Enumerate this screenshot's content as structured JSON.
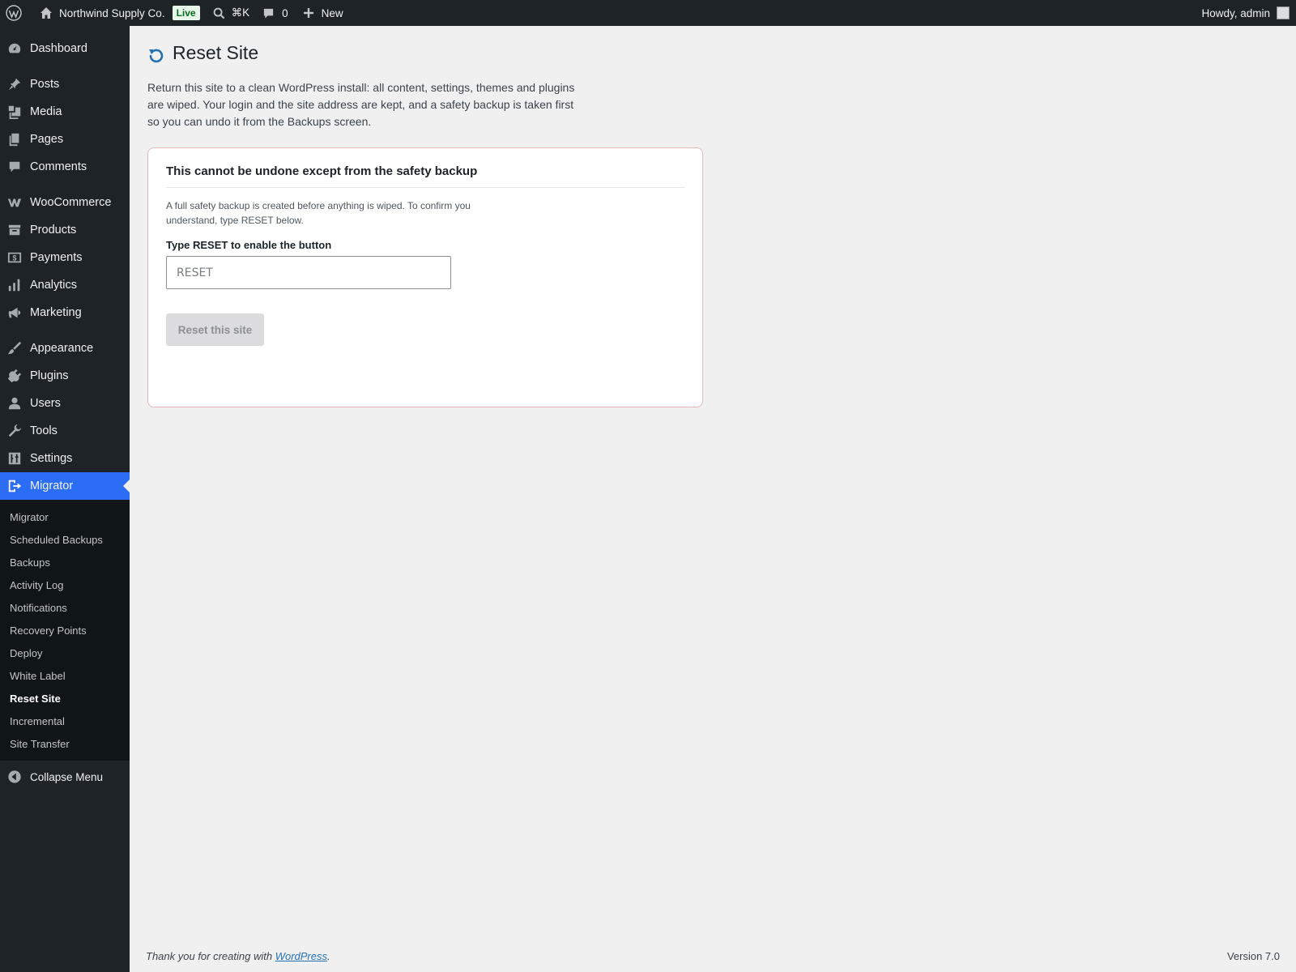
{
  "adminbar": {
    "site_name": "Northwind Supply Co.",
    "live_badge": "Live",
    "search_shortcut": "⌘K",
    "comments_count": "0",
    "new_label": "New",
    "greeting": "Howdy, admin"
  },
  "sidebar": {
    "items": [
      {
        "label": "Dashboard",
        "icon": "dashboard-icon"
      },
      {
        "label": "Posts",
        "icon": "pin-icon"
      },
      {
        "label": "Media",
        "icon": "media-icon"
      },
      {
        "label": "Pages",
        "icon": "pages-icon"
      },
      {
        "label": "Comments",
        "icon": "comment-icon"
      },
      {
        "label": "WooCommerce",
        "icon": "woocommerce-icon"
      },
      {
        "label": "Products",
        "icon": "archive-icon"
      },
      {
        "label": "Payments",
        "icon": "dollar-icon"
      },
      {
        "label": "Analytics",
        "icon": "bar-chart-icon"
      },
      {
        "label": "Marketing",
        "icon": "megaphone-icon"
      },
      {
        "label": "Appearance",
        "icon": "brush-icon"
      },
      {
        "label": "Plugins",
        "icon": "plug-icon"
      },
      {
        "label": "Users",
        "icon": "user-icon"
      },
      {
        "label": "Tools",
        "icon": "wrench-icon"
      },
      {
        "label": "Settings",
        "icon": "sliders-icon"
      },
      {
        "label": "Migrator",
        "icon": "migrate-icon"
      }
    ],
    "submenu": [
      "Migrator",
      "Scheduled Backups",
      "Backups",
      "Activity Log",
      "Notifications",
      "Recovery Points",
      "Deploy",
      "White Label",
      "Reset Site",
      "Incremental",
      "Site Transfer"
    ],
    "collapse_label": "Collapse Menu"
  },
  "main": {
    "title": "Reset Site",
    "intro": "Return this site to a clean WordPress install: all content, settings, themes and plugins are wiped. Your login and the site address are kept, and a safety backup is taken first so you can undo it from the Backups screen.",
    "card": {
      "title": "This cannot be undone except from the safety backup",
      "note": "A full safety backup is created before anything is wiped. To confirm you understand, type RESET below.",
      "field_label": "Type RESET to enable the button",
      "placeholder": "RESET",
      "button_label": "Reset this site"
    }
  },
  "footer": {
    "thanks_prefix": "Thank you for creating with",
    "thanks_link": "WordPress",
    "thanks_suffix": ".",
    "version": "Version 7.0"
  },
  "colors": {
    "accent": "#2b6ef5",
    "adminbar_bg": "#1d2327",
    "live_badge_text": "#0a6b1f",
    "card_border": "#e2b9b9",
    "reset_icon": "#2271b1"
  }
}
